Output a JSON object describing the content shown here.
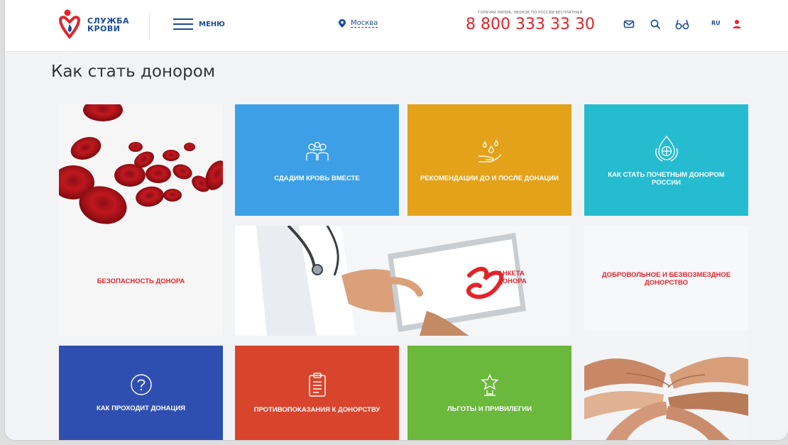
{
  "header": {
    "logo_line1": "СЛУЖБА",
    "logo_line2": "КРОВИ",
    "menu_label": "МЕНЮ",
    "city": "Москва",
    "hotline_caption": "ГОРЯЧАЯ ЛИНИЯ, ЗВОНОК ПО РОССИИ БЕСПЛАТНЫЙ",
    "phone": "8 800 333 33 30",
    "lang": "RU",
    "icons": [
      "mail-icon",
      "search-icon",
      "accessibility-glasses-icon",
      "user-icon"
    ]
  },
  "page": {
    "title": "Как стать донором"
  },
  "tiles": {
    "donor_safety": "БЕЗОПАСНОСТЬ ДОНОРА",
    "donate_together": "СДАДИМ КРОВЬ ВМЕСТЕ",
    "recommendations": "РЕКОМЕНДАЦИИ ДО И ПОСЛЕ ДОНАЦИИ",
    "honorary_donor": "КАК СТАТЬ ПОЧЕТНЫМ ДОНОРОМ РОССИИ",
    "donor_form": "АНКЕТА ДОНОРА",
    "voluntary": "ДОБРОВОЛЬНОЕ И БЕЗВОЗМЕЗДНОЕ ДОНОРСТВО",
    "how_donation": "КАК ПРОХОДИТ ДОНАЦИЯ",
    "contraindications": "ПРОТИВОПОКАЗАНИЯ К ДОНОРСТВУ",
    "benefits": "ЛЬГОТЫ И ПРИВИЛЕГИИ"
  },
  "colors": {
    "brand_blue": "#1c4b9a",
    "brand_red": "#e3242b",
    "tile_sky": "#3da0e6",
    "tile_orange": "#e3a21a",
    "tile_teal": "#26bcd0",
    "tile_navy": "#2f4fb0",
    "tile_red": "#d9442c",
    "tile_green": "#6ab83c"
  }
}
